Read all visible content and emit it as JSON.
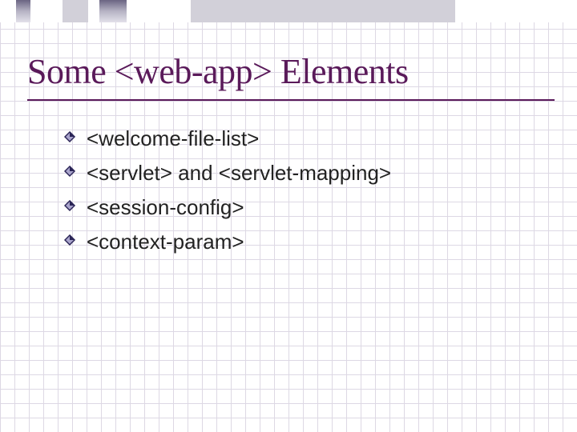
{
  "title": "Some <web-app> Elements",
  "bullets": [
    "<welcome-file-list>",
    "<servlet> and <servlet-mapping>",
    "<session-config>",
    "<context-param>"
  ],
  "colors": {
    "title": "#5a1a5a",
    "bullet_dark": "#2a2456",
    "bullet_light": "#a9a4cc"
  }
}
